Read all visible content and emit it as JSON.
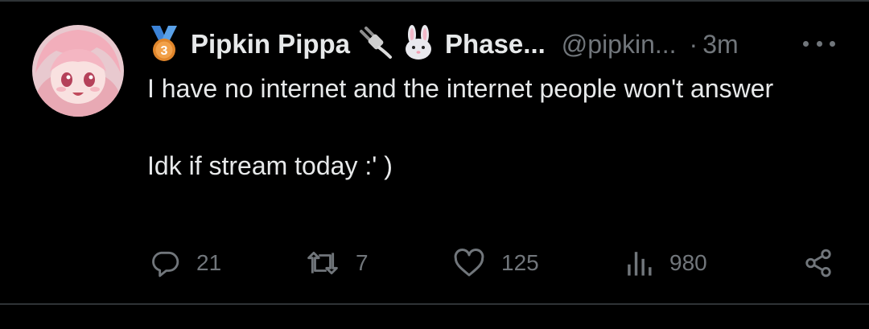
{
  "tweet": {
    "display_name": "Pipkin Pippa",
    "name_suffix": "Phase...",
    "handle": "@pipkin...",
    "separator": "·",
    "time": "3m",
    "lines": [
      "I have no internet and the internet people won't answer",
      "Idk if stream today :' )"
    ],
    "medal_number": "3",
    "name_emojis": [
      "🔌",
      "🐰"
    ]
  },
  "actions": {
    "replies": "21",
    "reposts": "7",
    "likes": "125",
    "views": "980"
  },
  "colors": {
    "background": "#000000",
    "text": "#e7e9ea",
    "muted": "#71767b",
    "divider": "#2f3336"
  }
}
